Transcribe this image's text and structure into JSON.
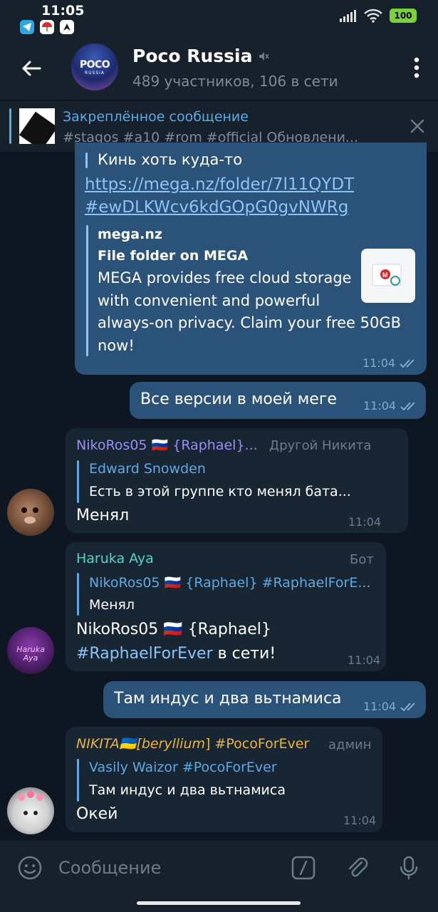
{
  "status_bar": {
    "time": "11:05",
    "battery": "100",
    "apps": [
      "telegram-icon",
      "umbrella-icon",
      "arrow-app-icon"
    ]
  },
  "header": {
    "title": "Poco Russia",
    "subtitle": "489 участников, 106 в сети",
    "avatar_logo": "POCO",
    "avatar_sub": "RUSSIA"
  },
  "pinned": {
    "title": "Закреплённое сообщение",
    "text": "#stagos #a10 #rom #official Обновлени..."
  },
  "messages": {
    "m1": {
      "text_top": "Кинь хоть куда-то",
      "link_line1": "https://mega.nz/folder/7l11QYDT",
      "link_line2": "#ewDLKWcv6kdGOpG0gvNWRg",
      "preview_site": "mega.nz",
      "preview_title": "File folder on MEGA",
      "preview_lines": [
        "MEGA provides free cloud storage",
        "with convenient and powerful",
        "always-on privacy. Claim your free 50GB",
        "now!"
      ],
      "time": "11:04"
    },
    "m2": {
      "text": "Все версии в моей меге",
      "time": "11:04"
    },
    "m3": {
      "sender": "NikoRos05 🇷🇺 {Raphael}...",
      "tag": "Другой Никита",
      "reply_name": "Edward Snowden",
      "reply_text": "Есть в этой группе кто менял бата...",
      "text": "Менял",
      "time": "11:04"
    },
    "m4": {
      "sender": "Haruka Aya",
      "tag": "Бот",
      "reply_name": "NikoRos05 🇷🇺 {Raphael} #RaphaelForE...",
      "reply_text": "Менял",
      "text_line1": "NikoRos05 🇷🇺 {Raphael}",
      "hashtag": "#RaphaelForEver",
      "text_line2_rest": " в сети!",
      "time": "11:04"
    },
    "m5": {
      "text": "Там индус и два вьтнамиса",
      "time": "11:04"
    },
    "m6": {
      "sender_prefix": "NIKITA🇺🇦[",
      "sender_italic": "beryllium",
      "sender_suffix": "] #PocoForEver",
      "tag": "админ",
      "reply_name": "Vasily Waizor #PocoForEver",
      "reply_text": "Там индус и два вьтнамиса",
      "text": "Окей",
      "time": "11:04"
    }
  },
  "avatar_texts": {
    "haruka": "Haruka Aya"
  },
  "input": {
    "placeholder": "Сообщение"
  },
  "colors": {
    "background": "#0e1621",
    "header": "#17212b",
    "outgoing_bubble": "#2b5278",
    "incoming_bubble": "#182533",
    "accent_blue": "#5fa9e4",
    "sender_purple": "#9a8ef0",
    "sender_teal": "#4fd6c9",
    "sender_gold": "#e9b73c"
  }
}
